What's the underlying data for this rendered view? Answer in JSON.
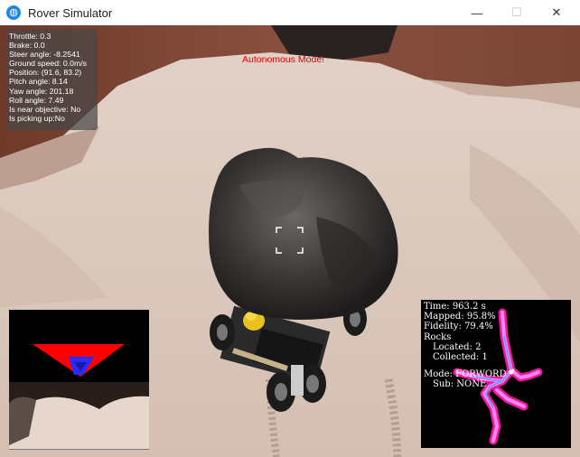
{
  "window": {
    "title": "Rover Simulator",
    "icon": "unity-icon"
  },
  "telemetry": {
    "throttle": "Throttle: 0.3",
    "brake": "Brake: 0.0",
    "steer": "Steer angle: -8.2541",
    "speed": "Ground speed: 0.0m/s",
    "position": "Position: (91.6, 83.2)",
    "pitch": "Pitch angle: 8.14",
    "yaw": "Yaw angle: 201.18",
    "roll": "Roll angle: 7.49",
    "near": "Is near objective: No",
    "picking": "Is picking up:No"
  },
  "mode_banner": "Autonomous Mode!",
  "stats": {
    "time": "Time: 963.2 s",
    "mapped": "Mapped: 95.8%",
    "fidelity": "Fidelity: 79.4%",
    "rocks": "Rocks",
    "located": "Located: 2",
    "collected": "Collected: 1",
    "mode": "Mode: FORWORD",
    "sub": "Sub: NONE"
  },
  "colors": {
    "banner": "#e00000",
    "navigable": "#2a2aff",
    "obstacle": "#ff0000",
    "ground": "#d8c6ba"
  }
}
